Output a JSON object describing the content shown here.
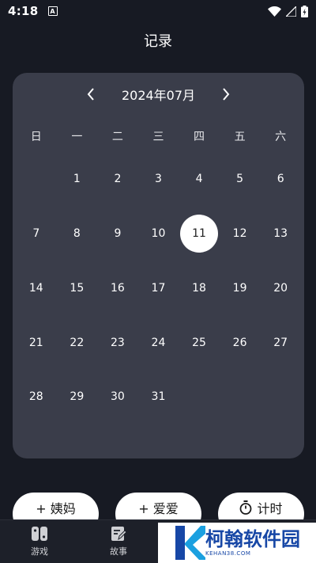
{
  "status_bar": {
    "time": "4:18",
    "notification_letter": "A"
  },
  "page": {
    "title": "记录"
  },
  "calendar": {
    "month_label": "2024年07月",
    "weekdays": [
      "日",
      "一",
      "二",
      "三",
      "四",
      "五",
      "六"
    ],
    "weeks": [
      [
        "",
        "1",
        "2",
        "3",
        "4",
        "5",
        "6"
      ],
      [
        "7",
        "8",
        "9",
        "10",
        "11",
        "12",
        "13"
      ],
      [
        "14",
        "15",
        "16",
        "17",
        "18",
        "19",
        "20"
      ],
      [
        "21",
        "22",
        "23",
        "24",
        "25",
        "26",
        "27"
      ],
      [
        "28",
        "29",
        "30",
        "31",
        "",
        "",
        ""
      ]
    ],
    "selected_day": "11"
  },
  "actions": {
    "period_label": "+ 姨妈",
    "love_label": "+ 爱爱",
    "timer_label": "计时"
  },
  "nav": {
    "games_label": "游戏",
    "stories_label": "故事"
  },
  "watermark": {
    "brand": "柯翰软件园",
    "site": "KEHAN38.COM"
  },
  "colors": {
    "background": "#171a23",
    "card": "#3a3d4a",
    "selected_day_bg": "#ffffff",
    "watermark_blue": "#1747a6"
  }
}
